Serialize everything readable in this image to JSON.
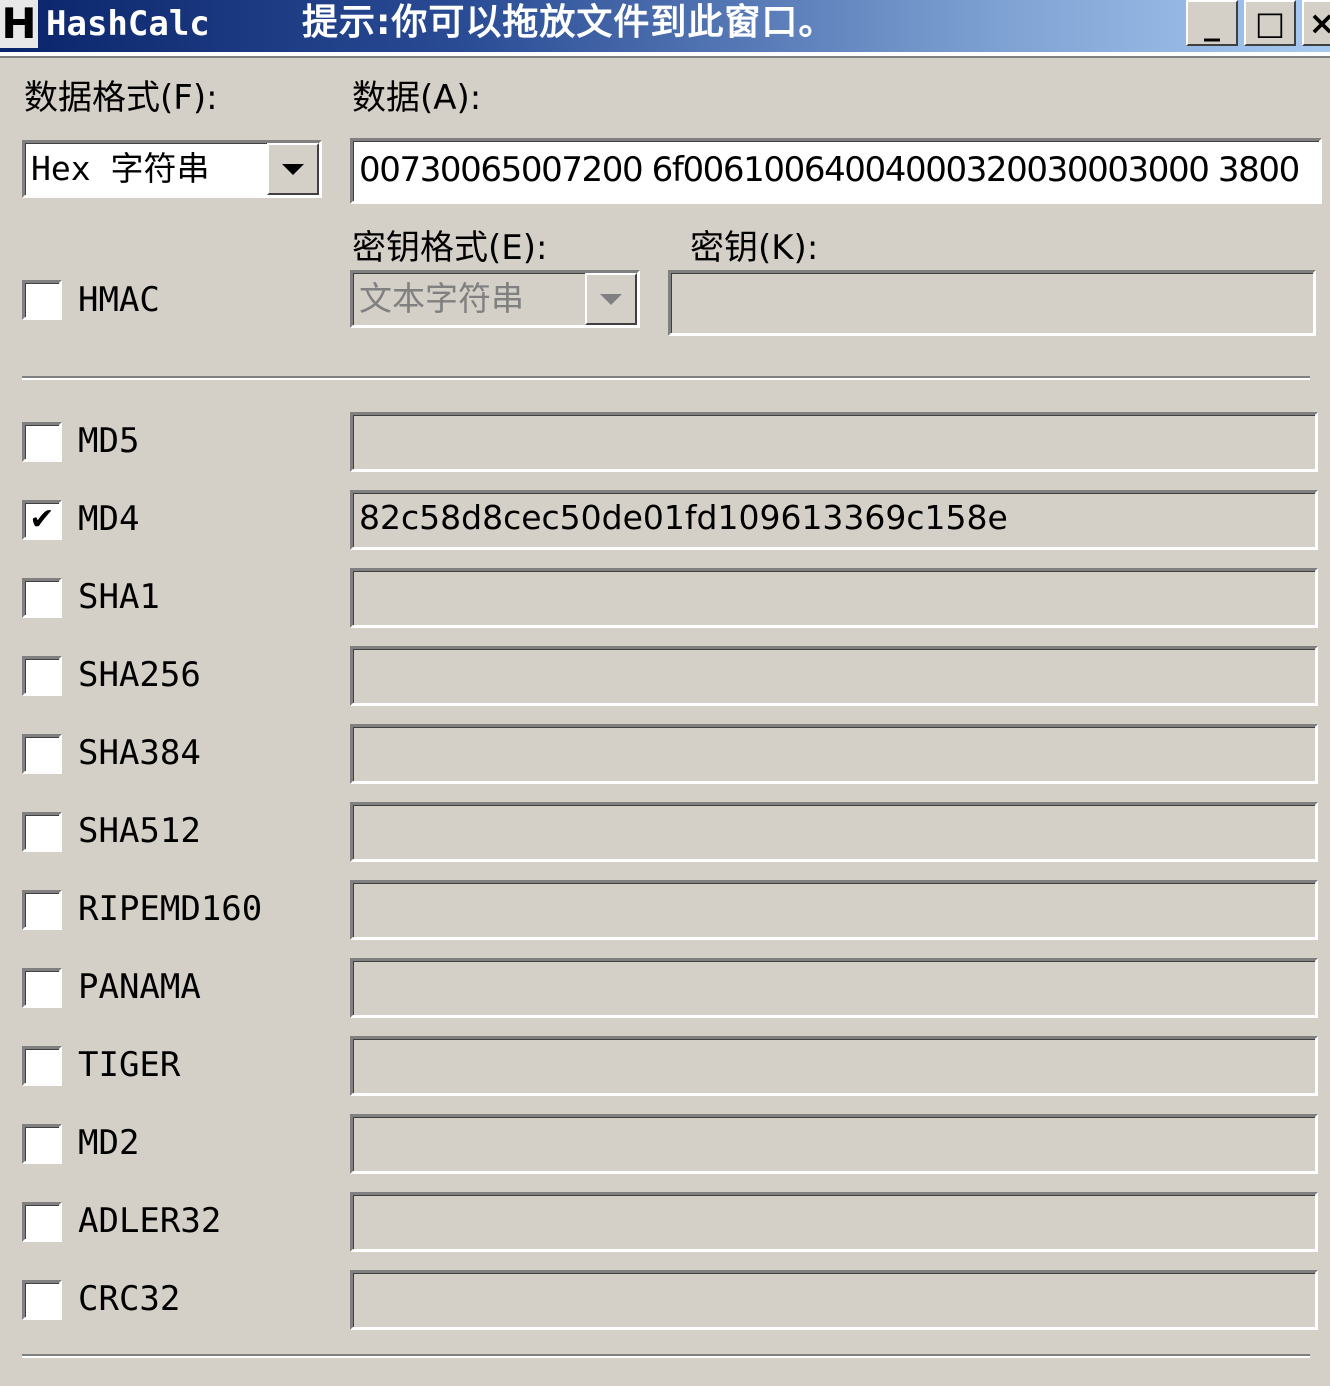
{
  "window": {
    "icon_letter": "H",
    "app_title": "HashCalc",
    "hint": "提示:你可以拖放文件到此窗口。",
    "buttons": {
      "minimize": "_",
      "maximize": "□",
      "close": "×"
    }
  },
  "input": {
    "data_format_label": "数据格式(F):",
    "data_format_value": "Hex 字符串",
    "data_label": "数据(A):",
    "data_value": "00730065007200 6f00610064004000320030003000 3800"
  },
  "hmac": {
    "checkbox_label": "HMAC",
    "checked": false,
    "key_format_label": "密钥格式(E):",
    "key_format_value": "文本字符串",
    "key_label": "密钥(K):",
    "key_value": ""
  },
  "algorithms": [
    {
      "name": "MD5",
      "checked": false,
      "result": ""
    },
    {
      "name": "MD4",
      "checked": true,
      "result": "82c58d8cec50de01fd109613369c158e"
    },
    {
      "name": "SHA1",
      "checked": false,
      "result": ""
    },
    {
      "name": "SHA256",
      "checked": false,
      "result": ""
    },
    {
      "name": "SHA384",
      "checked": false,
      "result": ""
    },
    {
      "name": "SHA512",
      "checked": false,
      "result": ""
    },
    {
      "name": "RIPEMD160",
      "checked": false,
      "result": ""
    },
    {
      "name": "PANAMA",
      "checked": false,
      "result": ""
    },
    {
      "name": "TIGER",
      "checked": false,
      "result": ""
    },
    {
      "name": "MD2",
      "checked": false,
      "result": ""
    },
    {
      "name": "ADLER32",
      "checked": false,
      "result": ""
    },
    {
      "name": "CRC32",
      "checked": false,
      "result": ""
    }
  ],
  "colors": {
    "title_gradient_start": "#0a246a",
    "title_gradient_end": "#a6caf0",
    "face": "#d4d0c8"
  }
}
